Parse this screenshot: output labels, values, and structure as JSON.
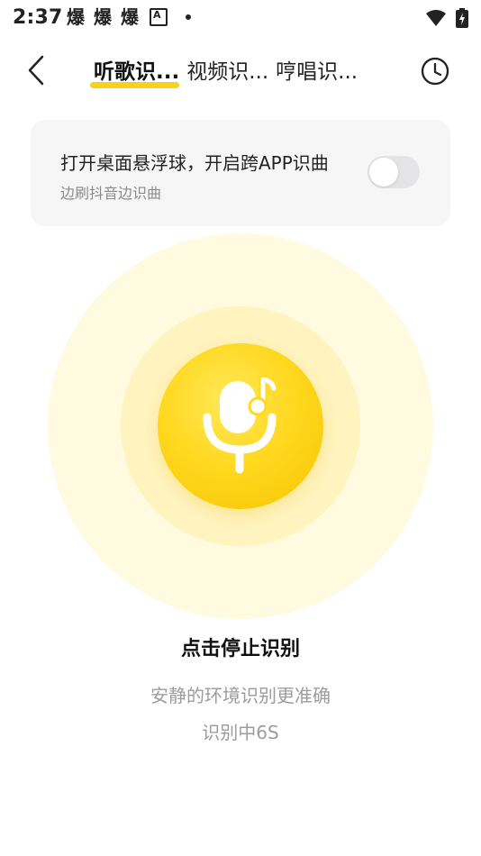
{
  "status_bar": {
    "time": "2:37",
    "notifications": [
      "爆",
      "爆",
      "爆"
    ],
    "icons": {
      "notif_a": "a-box-icon",
      "dot": "dot-icon",
      "wifi": "wifi-icon",
      "battery": "battery-charging-icon"
    }
  },
  "header": {
    "back_icon": "chevron-left-icon",
    "tabs": [
      {
        "label": "听歌识...",
        "active": true
      },
      {
        "label": "视频识...",
        "active": false
      },
      {
        "label": "哼唱识...",
        "active": false
      }
    ],
    "history_icon": "clock-icon",
    "accent_color": "#f7d21a"
  },
  "float_card": {
    "title": "打开桌面悬浮球，开启跨APP识曲",
    "subtitle": "边刷抖音边识曲",
    "toggle_on": false
  },
  "recognizer": {
    "icon": "microphone-music-note-icon",
    "button_color": "#ffd820",
    "stop_label": "点击停止识别",
    "hint": "安静的环境识别更准确",
    "status": "识别中6S"
  }
}
